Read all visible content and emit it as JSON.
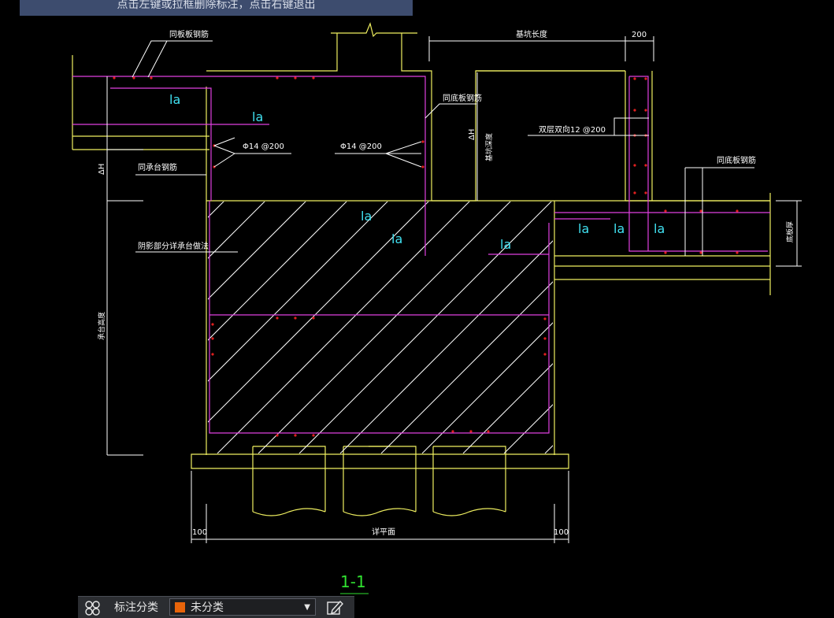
{
  "colors": {
    "structure": "#f0f060",
    "rebar": "#e040e0",
    "anchor": "#40e0f0",
    "dots": "#e02020",
    "dim": "#ffffff",
    "section": "#30e030",
    "swatch": "#e8640a"
  },
  "tip": {
    "text": "点击左键或拉框删除标注，点击右键退出"
  },
  "drawing": {
    "labels": {
      "tongbanban_top": "同板板钢筋",
      "tongdiban": "同底板钢筋",
      "tongchengtai": "同承台钢筋",
      "tongdiban_right": "同底板钢筋",
      "yinying": "阴影部分详承台做法",
      "shuangceng": "双层双向12 @200",
      "rebar_left": "Φ14 @200",
      "rebar_mid": "Φ14 @200",
      "dim_top": "基坑长度",
      "dim_200": "200",
      "dim_100_left": "100",
      "dim_100_right": "100",
      "dim_bottom": "详平面",
      "height_left": "ΔH",
      "height_mid": "ΔH",
      "height_mid2": "基坑深度",
      "chengtai_height": "承台高度",
      "diban_thick": "底板厚"
    },
    "la": [
      "la",
      "la",
      "la",
      "la",
      "la",
      "la",
      "la",
      "la"
    ],
    "section_title": "1-1"
  },
  "toolbar": {
    "icon": "annotation-category-icon",
    "label": "标注分类",
    "selected": "未分类",
    "edit_icon": "edit-icon"
  }
}
